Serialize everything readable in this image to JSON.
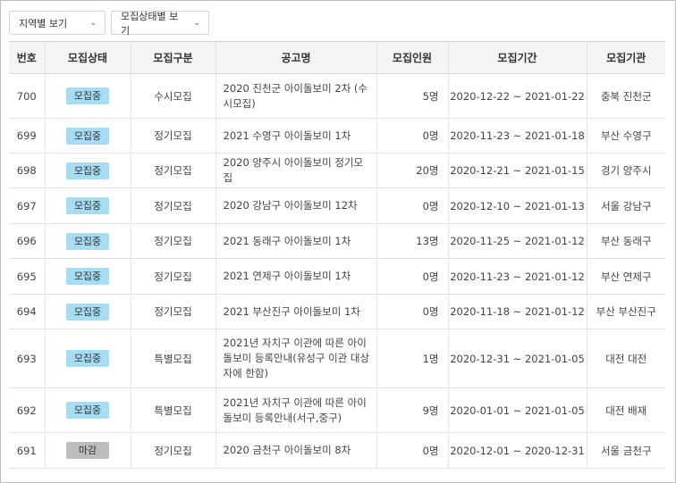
{
  "filters": {
    "region": "지역별 보기",
    "status": "모집상태별 보기"
  },
  "table": {
    "headers": [
      "번호",
      "모집상태",
      "모집구분",
      "공고명",
      "모집인원",
      "모집기간",
      "모집기관"
    ],
    "rows": [
      {
        "no": "700",
        "status": "모집중",
        "status_type": "open",
        "category": "수시모집",
        "title": "2020 진천군 아이돌보미 2차 (수시모집)",
        "count": "5명",
        "period": "2020-12-22 ~ 2021-01-22",
        "agency": "충북 진천군"
      },
      {
        "no": "699",
        "status": "모집중",
        "status_type": "open",
        "category": "정기모집",
        "title": "2021 수영구 아이돌보미 1차",
        "count": "0명",
        "period": "2020-11-23 ~ 2021-01-18",
        "agency": "부산 수영구"
      },
      {
        "no": "698",
        "status": "모집중",
        "status_type": "open",
        "category": "정기모집",
        "title": "2020 양주시 아이돌보미 정기모집",
        "count": "20명",
        "period": "2020-12-21 ~ 2021-01-15",
        "agency": "경기 양주시"
      },
      {
        "no": "697",
        "status": "모집중",
        "status_type": "open",
        "category": "정기모집",
        "title": "2020 강남구 아이돌보미 12차",
        "count": "0명",
        "period": "2020-12-10 ~ 2021-01-13",
        "agency": "서울 강남구"
      },
      {
        "no": "696",
        "status": "모집중",
        "status_type": "open",
        "category": "정기모집",
        "title": "2021 동래구 아이돌보미 1차",
        "count": "13명",
        "period": "2020-11-25 ~ 2021-01-12",
        "agency": "부산 동래구"
      },
      {
        "no": "695",
        "status": "모집중",
        "status_type": "open",
        "category": "정기모집",
        "title": "2021 연제구 아이돌보미 1차",
        "count": "0명",
        "period": "2020-11-23 ~ 2021-01-12",
        "agency": "부산 연제구"
      },
      {
        "no": "694",
        "status": "모집중",
        "status_type": "open",
        "category": "정기모집",
        "title": "2021 부산진구 아이돌보미 1차",
        "count": "0명",
        "period": "2020-11-18 ~ 2021-01-12",
        "agency": "부산 부산진구"
      },
      {
        "no": "693",
        "status": "모집중",
        "status_type": "open",
        "category": "특별모집",
        "title": "2021년 자치구 이관에 따른 아이돌보미 등록안내(유성구 이관 대상자에 한함)",
        "count": "1명",
        "period": "2020-12-31 ~ 2021-01-05",
        "agency": "대전 대전"
      },
      {
        "no": "692",
        "status": "모집중",
        "status_type": "open",
        "category": "특별모집",
        "title": "2021년 자치구 이관에 따른 아이돌보미 등록안내(서구,중구)",
        "count": "9명",
        "period": "2020-01-01 ~ 2021-01-05",
        "agency": "대전 배재"
      },
      {
        "no": "691",
        "status": "마감",
        "status_type": "closed",
        "category": "정기모집",
        "title": "2020 금천구 아이돌보미 8차",
        "count": "0명",
        "period": "2020-12-01 ~ 2020-12-31",
        "agency": "서울 금천구"
      }
    ]
  },
  "icons": {
    "dropdown": "chevron-down-icon"
  },
  "colors": {
    "badge_open": "#a6dcf4",
    "badge_closed": "#bdbdbd",
    "header_bg": "#f4f4f4"
  }
}
